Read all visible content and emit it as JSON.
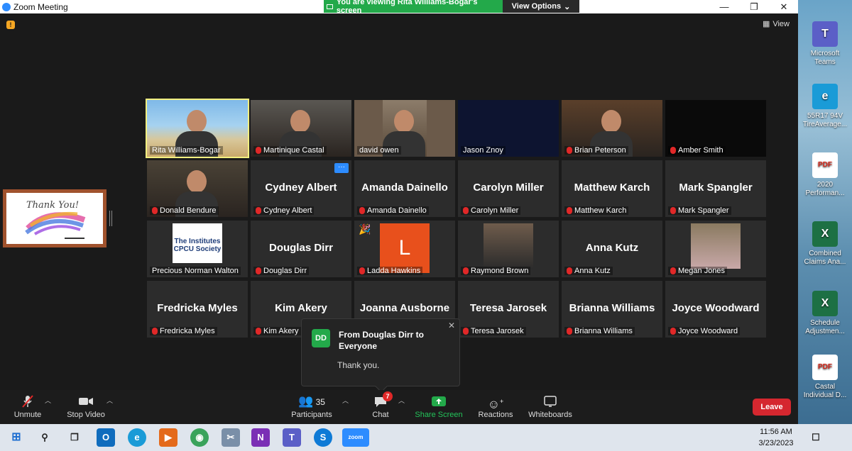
{
  "window": {
    "title": "Zoom Meeting",
    "viewing_banner": "You are viewing Rita Williams-Bogar's screen",
    "view_options": "View Options",
    "view_label": "View"
  },
  "participants": [
    {
      "name": "Rita Williams-Bogar",
      "display": "",
      "muted": false,
      "video": true,
      "bg": "#3a8fd1"
    },
    {
      "name": "Martinique Castal",
      "display": "",
      "muted": true,
      "video": true,
      "bg": "#5a5752"
    },
    {
      "name": "david owen",
      "display": "",
      "muted": false,
      "video": true,
      "bg": "#6b5a4a"
    },
    {
      "name": "Jason Znoy",
      "display": "",
      "muted": false,
      "video": true,
      "bg": "#0d1430"
    },
    {
      "name": "Brian Peterson",
      "display": "",
      "muted": true,
      "video": true,
      "bg": "#5a3f2a"
    },
    {
      "name": "Amber Smith",
      "display": "",
      "muted": true,
      "video": true,
      "bg": "#0a0a0a"
    },
    {
      "name": "Donald Bendure",
      "display": "",
      "muted": true,
      "video": true,
      "bg": "#4a4236"
    },
    {
      "name": "Cydney Albert",
      "display": "Cydney Albert",
      "muted": true,
      "video": false,
      "bg": "#2c2c2c"
    },
    {
      "name": "Amanda Dainello",
      "display": "Amanda Dainello",
      "muted": true,
      "video": false,
      "bg": "#2c2c2c"
    },
    {
      "name": "Carolyn Miller",
      "display": "Carolyn Miller",
      "muted": true,
      "video": false,
      "bg": "#2c2c2c"
    },
    {
      "name": "Matthew Karch",
      "display": "Matthew Karch",
      "muted": true,
      "video": false,
      "bg": "#2c2c2c"
    },
    {
      "name": "Mark Spangler",
      "display": "Mark Spangler",
      "muted": true,
      "video": false,
      "bg": "#2c2c2c"
    },
    {
      "name": "Precious Norman Walton",
      "display": "",
      "muted": false,
      "video": true,
      "bg": "#2c2c2c"
    },
    {
      "name": "Douglas Dirr",
      "display": "Douglas Dirr",
      "muted": true,
      "video": false,
      "bg": "#2c2c2c"
    },
    {
      "name": "Ladda Hawkins",
      "display": "",
      "muted": true,
      "video": false,
      "bg": "#2c2c2c"
    },
    {
      "name": "Raymond Brown",
      "display": "",
      "muted": true,
      "video": false,
      "bg": "#2c2c2c"
    },
    {
      "name": "Anna Kutz",
      "display": "Anna Kutz",
      "muted": true,
      "video": false,
      "bg": "#2c2c2c"
    },
    {
      "name": "Megan Jones",
      "display": "",
      "muted": true,
      "video": false,
      "bg": "#2c2c2c"
    },
    {
      "name": "Fredricka Myles",
      "display": "Fredricka Myles",
      "muted": true,
      "video": false,
      "bg": "#2c2c2c"
    },
    {
      "name": "Kim Akery",
      "display": "Kim Akery",
      "muted": true,
      "video": false,
      "bg": "#2c2c2c"
    },
    {
      "name": "Joanna Ausborne",
      "display": "Joanna Ausborne",
      "muted": true,
      "video": false,
      "bg": "#2c2c2c"
    },
    {
      "name": "Teresa Jarosek",
      "display": "Teresa Jarosek",
      "muted": true,
      "video": false,
      "bg": "#2c2c2c"
    },
    {
      "name": "Brianna Williams",
      "display": "Brianna Williams",
      "muted": true,
      "video": false,
      "bg": "#2c2c2c"
    },
    {
      "name": "Joyce Woodward",
      "display": "Joyce Woodward",
      "muted": true,
      "video": false,
      "bg": "#2c2c2c"
    }
  ],
  "cpcu_logo": [
    "The Institutes",
    "CPCU Society"
  ],
  "ladda_initial": "L",
  "shared_screen_text": "Thank You!",
  "chat_toast": {
    "initials": "DD",
    "from": "From Douglas Dirr to Everyone",
    "message": "Thank you."
  },
  "toolbar": {
    "unmute": "Unmute",
    "stop_video": "Stop Video",
    "participants": "Participants",
    "participants_count": "35",
    "chat": "Chat",
    "chat_badge": "7",
    "share_screen": "Share Screen",
    "reactions": "Reactions",
    "whiteboards": "Whiteboards",
    "leave": "Leave"
  },
  "desktop_icons": [
    {
      "label": "Microsoft Teams",
      "type": "teams"
    },
    {
      "label": "55R17 94V TireAverage...",
      "type": "edge"
    },
    {
      "label": "2020 Performan...",
      "type": "pdf"
    },
    {
      "label": "Combined Claims Ana...",
      "type": "excel"
    },
    {
      "label": "Schedule Adjustmen...",
      "type": "excel"
    },
    {
      "label": "Castal Individual D...",
      "type": "pdf"
    }
  ],
  "taskbar": {
    "time": "11:56 AM",
    "date": "3/23/2023"
  },
  "colors": {
    "accent_green": "#23a94a",
    "leave_red": "#d5272f",
    "active_speaker": "#f2f080"
  }
}
